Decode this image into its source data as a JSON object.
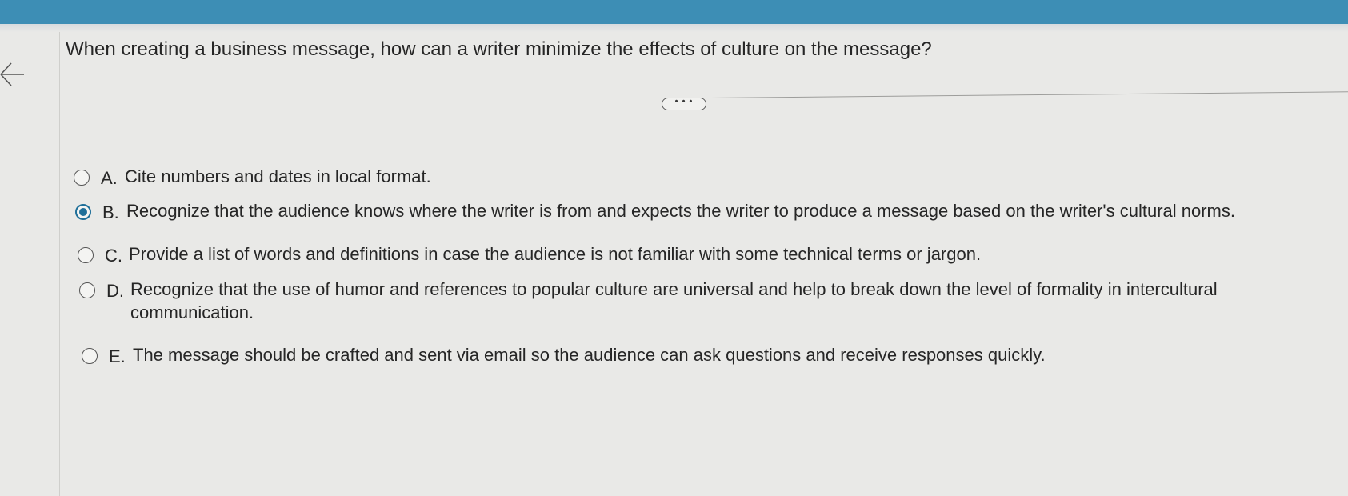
{
  "question": {
    "text": "When creating a business message, how can a writer minimize the effects of culture on the message?"
  },
  "more_button": {
    "label": "• • •"
  },
  "options": [
    {
      "letter": "A.",
      "text": "Cite numbers and dates in local format.",
      "selected": false
    },
    {
      "letter": "B.",
      "text": "Recognize that the audience knows where the writer is from and expects the writer to produce a message based on the writer's cultural norms.",
      "selected": true
    },
    {
      "letter": "C.",
      "text": "Provide a list of words and definitions in case the audience is not familiar with some technical terms or jargon.",
      "selected": false
    },
    {
      "letter": "D.",
      "text": "Recognize that the use of humor and references to popular culture are universal and help to break down the level of formality in intercultural communication.",
      "selected": false
    },
    {
      "letter": "E.",
      "text": "The message should be crafted and sent via email so the audience can ask questions and receive responses quickly.",
      "selected": false
    }
  ],
  "colors": {
    "header": "#3d8eb5",
    "selected_radio": "#1f6f99",
    "background": "#e9e9e7"
  },
  "icons": {
    "back": "arrow-left-icon"
  }
}
